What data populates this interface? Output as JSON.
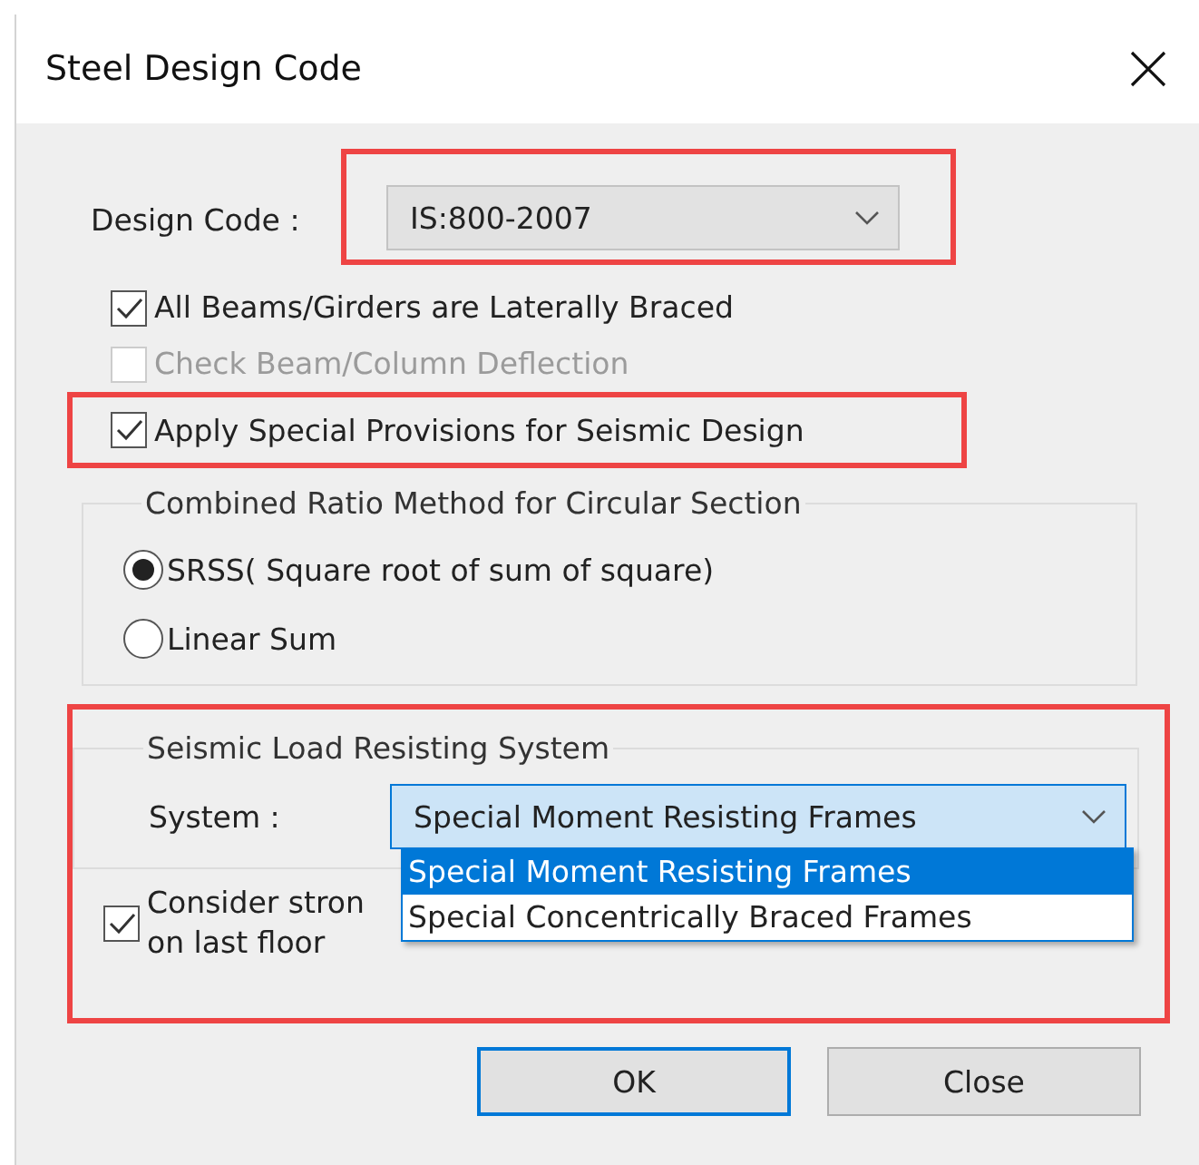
{
  "window": {
    "title": "Steel Design Code"
  },
  "design_code": {
    "label": "Design Code :",
    "value": "IS:800-2007",
    "highlighted": true
  },
  "options": [
    {
      "label": "All Beams/Girders are Laterally Braced",
      "checked": true,
      "disabled": false,
      "highlighted": false
    },
    {
      "label": "Check Beam/Column Deflection",
      "checked": false,
      "disabled": true,
      "highlighted": false
    },
    {
      "label": "Apply Special Provisions for Seismic Design",
      "checked": true,
      "disabled": false,
      "highlighted": true
    }
  ],
  "combined_ratio": {
    "title": "Combined Ratio Method for Circular Section",
    "options": [
      {
        "label": "SRSS( Square root of sum of square)",
        "selected": true
      },
      {
        "label": "Linear Sum",
        "selected": false
      }
    ]
  },
  "seismic": {
    "highlighted": true,
    "title": "Seismic Load Resisting System",
    "system_label": "System :",
    "system_value": "Special Moment Resisting Frames",
    "dropdown": [
      {
        "label": "Special Moment Resisting Frames",
        "selected": true
      },
      {
        "label": "Special Concentrically Braced Frames",
        "selected": false
      }
    ],
    "strong_column": {
      "lines": [
        "Consider stron",
        "on last floor"
      ],
      "checked": true
    }
  },
  "buttons": [
    {
      "label": "OK",
      "focused": true
    },
    {
      "label": "Close",
      "focused": false
    }
  ]
}
